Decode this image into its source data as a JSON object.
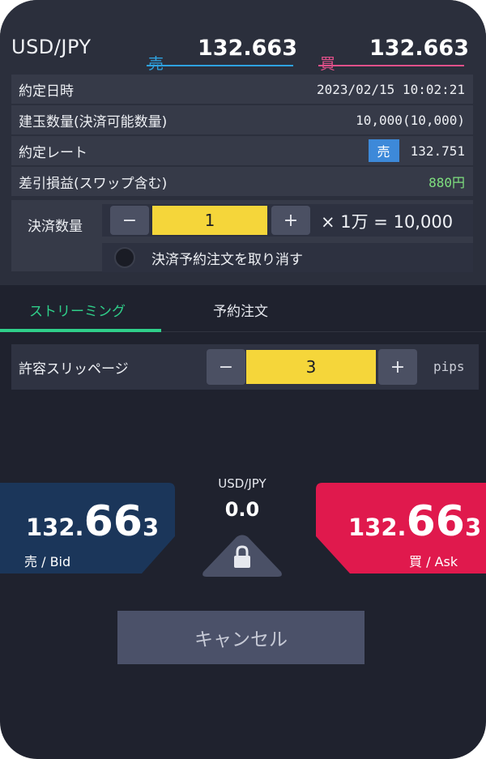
{
  "header": {
    "pair": "USD/JPY",
    "sell_label": "売",
    "sell_price": "132.663",
    "buy_label": "買",
    "buy_price": "132.663"
  },
  "info": {
    "contract_datetime_label": "約定日時",
    "contract_datetime_value": "2023/02/15 10:02:21",
    "position_qty_label": "建玉数量(決済可能数量)",
    "position_qty_value": "10,000(10,000)",
    "contract_rate_label": "約定レート",
    "contract_rate_side": "売",
    "contract_rate_value": "132.751",
    "pnl_label": "差引損益(スワップ含む)",
    "pnl_value": "880円"
  },
  "settlement": {
    "qty_label": "決済数量",
    "minus": "−",
    "plus": "+",
    "qty_value": "1",
    "multiplier_text": "× 1万 = 10,000",
    "cancel_reserve_label": "決済予約注文を取り消す"
  },
  "tabs": [
    {
      "label": "ストリーミング",
      "active": true
    },
    {
      "label": "予約注文",
      "active": false
    }
  ],
  "slippage": {
    "label": "許容スリッページ",
    "minus": "−",
    "plus": "+",
    "value": "3",
    "unit": "pips"
  },
  "quote": {
    "pair": "USD/JPY",
    "spread": "0.0",
    "bid_small": "132.",
    "bid_large": "66",
    "bid_last": "3",
    "bid_label": "売 / Bid",
    "ask_small": "132.",
    "ask_large": "66",
    "ask_last": "3",
    "ask_label": "買 / Ask",
    "lock_icon": "lock-icon"
  },
  "cancel_button": "キャンセル",
  "colors": {
    "sell_blue": "#2ea2e0",
    "buy_pink": "#e2508a",
    "bid_bg": "#1b365a",
    "ask_bg": "#e0194d",
    "accent_green": "#2fcf8a",
    "stepper_yellow": "#f5d63a"
  }
}
